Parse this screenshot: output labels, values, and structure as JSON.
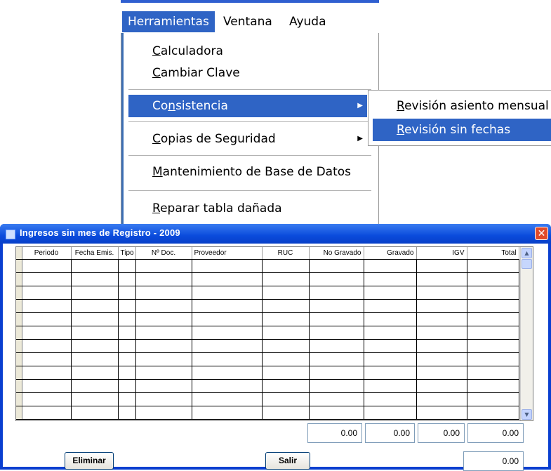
{
  "menubar": {
    "items": [
      {
        "label": "Herramientas",
        "active": true
      },
      {
        "label": "Ventana",
        "active": false
      },
      {
        "label": "Ayuda",
        "active": false
      }
    ]
  },
  "dropdown": {
    "items": [
      {
        "label": "Calculadora",
        "mnemonic": "C"
      },
      {
        "label": "Cambiar Clave",
        "mnemonic": "C"
      },
      {
        "label": "Consistencia",
        "mnemonic": "s",
        "submenu": true,
        "selected": true
      },
      {
        "label": "Copias de Seguridad",
        "mnemonic": "C",
        "submenu": true
      },
      {
        "label": "Mantenimiento de Base de Datos",
        "mnemonic": "M"
      },
      {
        "label": "Reparar tabla dañada",
        "mnemonic": "R"
      }
    ]
  },
  "submenu": {
    "items": [
      {
        "label": "Revisión asiento mensual",
        "selected": false
      },
      {
        "label": "Revisión sin fechas",
        "selected": true
      }
    ]
  },
  "window": {
    "title": "Ingresos sin mes de Registro  - 2009",
    "close_label": "✕",
    "columns": [
      "Periodo",
      "Fecha Emis.",
      "Tipo",
      "Nº Doc.",
      "Proveedor",
      "RUC",
      "No Gravado",
      "Gravado",
      "IGV",
      "Total"
    ],
    "rows": [
      [
        "",
        "",
        "",
        "",
        "",
        "",
        "",
        "",
        "",
        ""
      ],
      [
        "",
        "",
        "",
        "",
        "",
        "",
        "",
        "",
        "",
        ""
      ],
      [
        "",
        "",
        "",
        "",
        "",
        "",
        "",
        "",
        "",
        ""
      ],
      [
        "",
        "",
        "",
        "",
        "",
        "",
        "",
        "",
        "",
        ""
      ],
      [
        "",
        "",
        "",
        "",
        "",
        "",
        "",
        "",
        "",
        ""
      ],
      [
        "",
        "",
        "",
        "",
        "",
        "",
        "",
        "",
        "",
        ""
      ],
      [
        "",
        "",
        "",
        "",
        "",
        "",
        "",
        "",
        "",
        ""
      ],
      [
        "",
        "",
        "",
        "",
        "",
        "",
        "",
        "",
        "",
        ""
      ],
      [
        "",
        "",
        "",
        "",
        "",
        "",
        "",
        "",
        "",
        ""
      ],
      [
        "",
        "",
        "",
        "",
        "",
        "",
        "",
        "",
        "",
        ""
      ],
      [
        "",
        "",
        "",
        "",
        "",
        "",
        "",
        "",
        "",
        ""
      ],
      [
        "",
        "",
        "",
        "",
        "",
        "",
        "",
        "",
        "",
        ""
      ]
    ],
    "totals": {
      "no_gravado": "0.00",
      "gravado": "0.00",
      "igv": "0.00",
      "total": "0.00"
    },
    "grand_total": "0.00",
    "eliminar_label": "Eliminar",
    "salir_label": "Salir"
  },
  "colors": {
    "selection": "#2f64c5",
    "titlebar": "#0a4bdc"
  }
}
